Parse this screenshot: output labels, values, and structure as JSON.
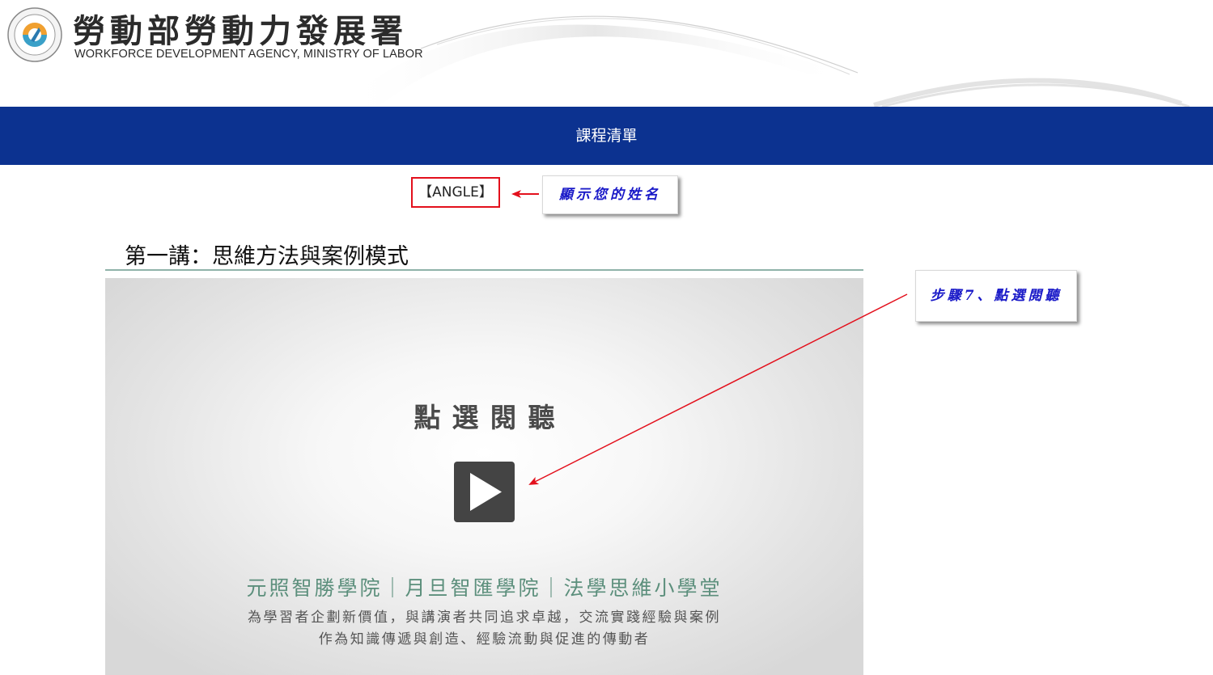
{
  "header": {
    "org_name_cn": "勞動部勞動力發展署",
    "org_name_en": "WORKFORCE DEVELOPMENT AGENCY, MINISTRY OF LABOR"
  },
  "nav": {
    "title": "課程清單"
  },
  "user": {
    "name": "【ANGLE】"
  },
  "annotations": {
    "name_hint": "顯示您的姓名",
    "step_hint": "步驟7、點選閱聽",
    "color": "#e3101c"
  },
  "course": {
    "title": "第一講：思維方法與案例模式"
  },
  "video": {
    "title": "點選閱聽",
    "subtitle": "元照智勝學院｜月旦智匯學院｜法學思維小學堂",
    "desc_line1": "為學習者企劃新價值，與講演者共同追求卓越，交流實踐經驗與案例",
    "desc_line2": "作為知識傳遞與創造、經驗流動與促進的傳動者"
  },
  "colors": {
    "navbar": "#0c3290",
    "callout_text": "#1a1ac8",
    "subtitle_green": "#5c8f7c",
    "play_button": "#444444"
  }
}
